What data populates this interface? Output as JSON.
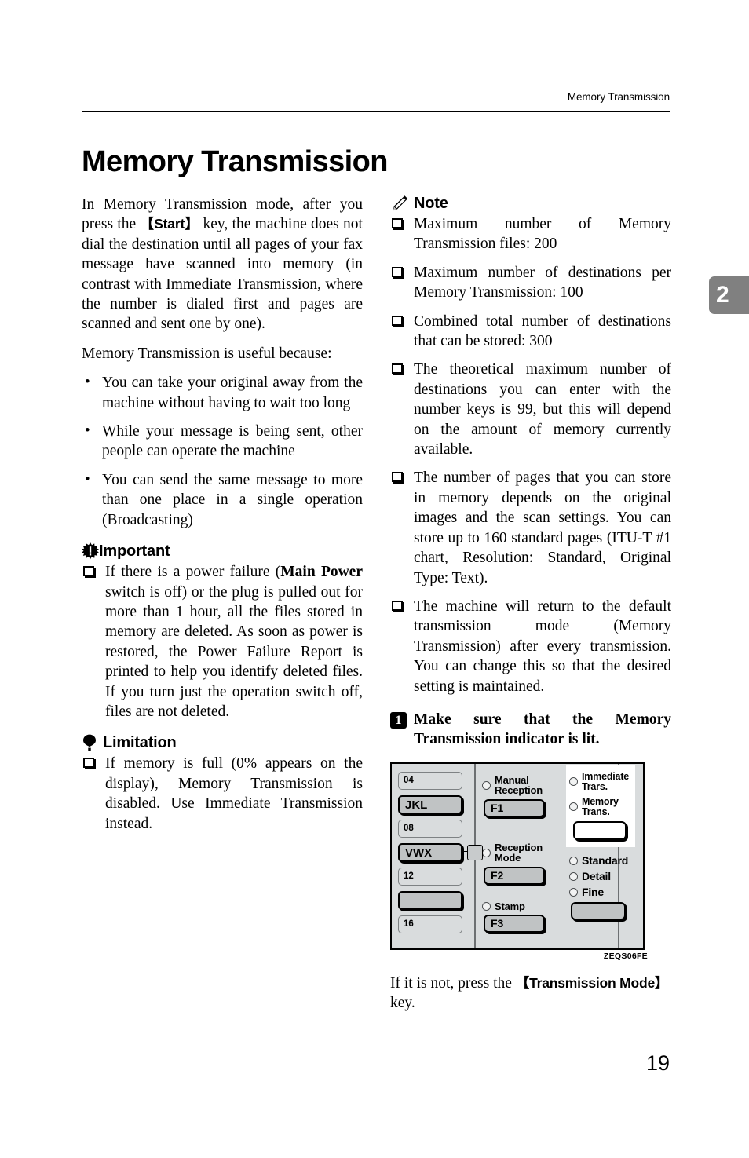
{
  "header": {
    "running_head": "Memory Transmission",
    "chapter_tab": "2"
  },
  "title": "Memory Transmission",
  "left_column": {
    "intro_p1_a": "In Memory Transmission mode, after you press the ",
    "intro_key": "【Start】",
    "intro_p1_b": " key, the machine does not dial the destination until all pages of your fax message have scanned into memory (in contrast with Immediate Transmission, where the number is dialed first and pages are scanned and sent one by one).",
    "intro_p2": "Memory Transmission is useful because:",
    "bullets": [
      "You can take your original away from the machine without having to wait too long",
      "While your message is being sent, other people can operate the machine",
      "You can send the same message to more than one place in a single operation (Broadcasting)"
    ],
    "important": {
      "heading": "Important",
      "icon": "important-starburst-icon",
      "items_a": "If there is a power failure (",
      "items_bold1": "Main Power",
      "items_b": " switch is off) or the plug is pulled out for more than 1 hour, all the files stored in memory are deleted. As soon as power is restored, the Power Failure Report is printed to help you identify deleted files. If you turn just the operation switch off, files are not deleted."
    },
    "limitation": {
      "heading": "Limitation",
      "icon": "limitation-balloon-icon",
      "item": "If memory is full (0% appears on the display), Memory Transmission is disabled. Use Immediate Transmission instead."
    }
  },
  "right_column": {
    "note": {
      "heading": "Note",
      "icon": "note-pencil-icon",
      "items": [
        "Maximum number of Memory Transmission files: 200",
        "Maximum number of destinations per Memory Transmission: 100",
        "Combined total number of destinations that can be stored: 300",
        "The theoretical maximum number of destinations you can enter with the number keys is 99, but this will depend on the amount of memory currently available.",
        "The number of pages that you can store in memory depends on the original images and the scan settings. You can store up to 160 standard pages (ITU-T #1 chart, Resolution: Standard, Original Type: Text).",
        "The machine will return to the default transmission mode (Memory Transmission) after every transmission. You can change this so that the desired setting is maintained."
      ]
    },
    "step": {
      "number": "1",
      "text": "Make sure that the Memory Transmission indicator is lit."
    },
    "figure": {
      "caption": "ZEQS06FE",
      "quick_dial_keys": [
        {
          "label": "04",
          "type": "number"
        },
        {
          "label": "JKL",
          "type": "alpha"
        },
        {
          "label": "08",
          "type": "number"
        },
        {
          "label": "VWX",
          "type": "alpha"
        },
        {
          "label": "12",
          "type": "number"
        },
        {
          "label": "",
          "type": "alpha"
        },
        {
          "label": "16",
          "type": "number"
        }
      ],
      "function_keys": [
        {
          "lamp_label": "Manual\nReception",
          "key_label": "F1"
        },
        {
          "lamp_label": "Reception\nMode",
          "key_label": "F2"
        },
        {
          "lamp_label": "Stamp",
          "key_label": "F3"
        }
      ],
      "transmission_mode": {
        "lamps": [
          "Immediate\nTrars.",
          "Memory\nTrans."
        ],
        "key_label": ""
      },
      "resolution": {
        "lamps": [
          "Standard",
          "Detail",
          "Fine"
        ],
        "key_label": ""
      }
    },
    "after_figure_a": "If it is not, press the ",
    "after_figure_key": "【Transmission Mode】",
    "after_figure_b": " key."
  },
  "page_number": "19"
}
